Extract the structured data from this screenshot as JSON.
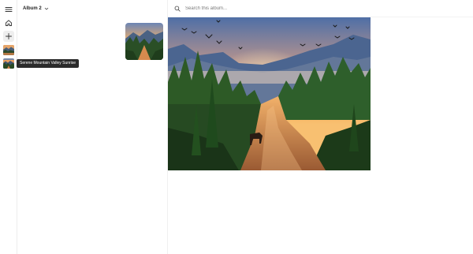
{
  "sidebar": {
    "menu_icon": "hamburger-menu-icon",
    "home_icon": "home-icon",
    "add_icon": "plus-icon",
    "thumbnails": [
      "landscape-thumbnail",
      "landscape-thumbnail"
    ]
  },
  "tooltip": {
    "text": "Serene Mountain Valley Sunrise"
  },
  "album": {
    "title": "Album 2",
    "dropdown_icon": "chevron-down-icon"
  },
  "search": {
    "placeholder": "Search this album...",
    "icon": "search-icon"
  },
  "colors": {
    "tooltip_bg": "#2b2b2b",
    "sky_top": "#5a7bb0",
    "sunrise": "#f7a14a",
    "forest": "#2f5a2a",
    "water": "#d98a4c"
  }
}
